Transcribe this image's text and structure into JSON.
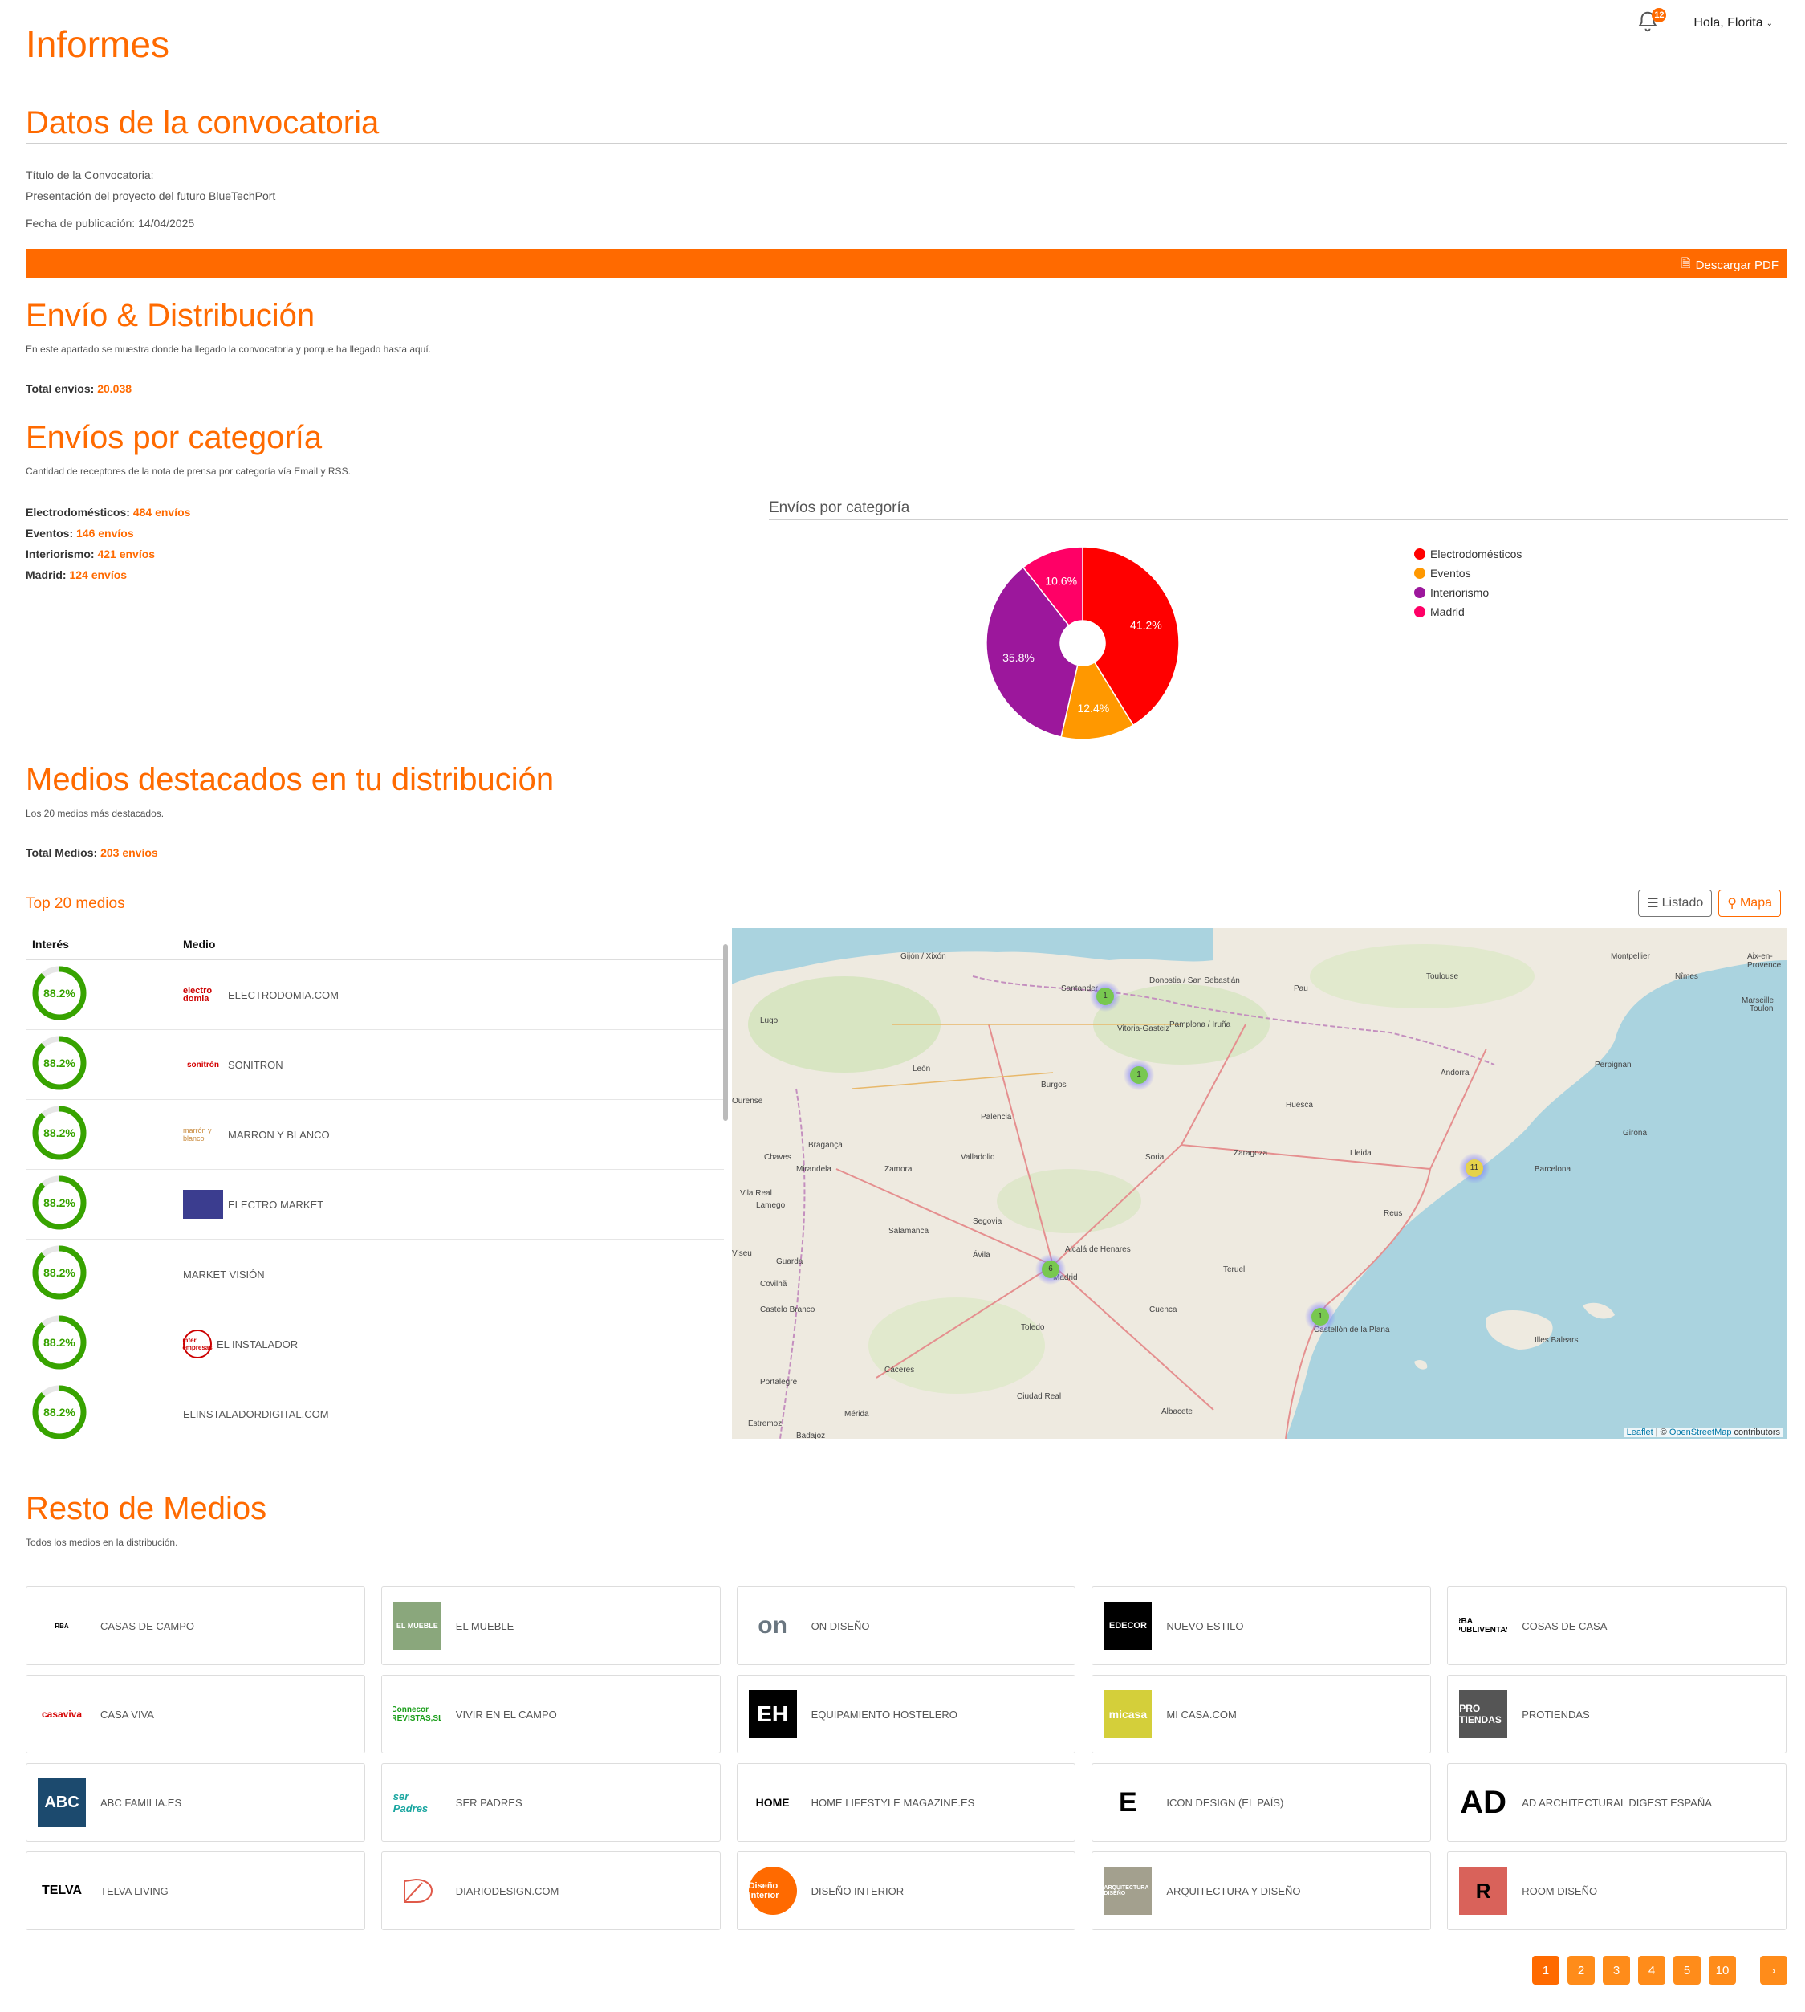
{
  "header": {
    "title": "Informes",
    "greeting": "Hola, Florita",
    "notification_count": "12"
  },
  "convocatoria": {
    "section_title": "Datos de la convocatoria",
    "title_label": "Título de la Convocatoria:",
    "title_value": "Presentación del proyecto del futuro BlueTechPort",
    "date_text": "Fecha de publicación: 14/04/2025",
    "pdf_button": "Descargar PDF"
  },
  "envio": {
    "section_title": "Envío & Distribución",
    "description": "En este apartado se muestra donde ha llegado la convocatoria y porque ha llegado hasta aquí.",
    "total_label": "Total envíos:",
    "total_value": "20.038"
  },
  "categorias": {
    "section_title": "Envíos por categoría",
    "description": "Cantidad de receptores de la nota de prensa por categoría vía Email y RSS.",
    "items": [
      {
        "label": "Electrodomésticos:",
        "value": "484 envíos"
      },
      {
        "label": "Eventos:",
        "value": "146 envíos"
      },
      {
        "label": "Interiorismo:",
        "value": "421 envíos"
      },
      {
        "label": "Madrid:",
        "value": "124 envíos"
      }
    ]
  },
  "chart_data": {
    "type": "pie",
    "title": "Envíos por categoría",
    "categories": [
      "Electrodomésticos",
      "Eventos",
      "Interiorismo",
      "Madrid"
    ],
    "values": [
      41.2,
      12.4,
      35.8,
      10.6
    ],
    "value_labels": [
      "41.2%",
      "12.4%",
      "35.8%",
      "10.6%"
    ],
    "colors": [
      "#ff0000",
      "#ff9800",
      "#9c179c",
      "#ff0066"
    ],
    "legend_position": "right"
  },
  "medios": {
    "section_title": "Medios destacados en tu distribución",
    "description": "Los 20 medios más destacados.",
    "total_label": "Total Medios:",
    "total_value": "203 envíos",
    "top_label": "Top 20 medios",
    "btn_list": "Listado",
    "btn_map": "Mapa",
    "col_interes": "Interés",
    "col_medio": "Medio",
    "rows": [
      {
        "interes": "88.2%",
        "interes_value": 0.882,
        "medio": "ELECTRODOMIA.COM",
        "logo": "electro domia"
      },
      {
        "interes": "88.2%",
        "interes_value": 0.882,
        "medio": "SONITRON",
        "logo": "sonitrón"
      },
      {
        "interes": "88.2%",
        "interes_value": 0.882,
        "medio": "MARRON Y BLANCO",
        "logo": "marrón y blanco"
      },
      {
        "interes": "88.2%",
        "interes_value": 0.882,
        "medio": "ELECTRO MARKET",
        "logo": ""
      },
      {
        "interes": "88.2%",
        "interes_value": 0.882,
        "medio": "MARKET VISIÓN",
        "logo": ""
      },
      {
        "interes": "88.2%",
        "interes_value": 0.882,
        "medio": "EL INSTALADOR",
        "logo": "inter empresas"
      },
      {
        "interes": "88.2%",
        "interes_value": 0.882,
        "medio": "ELINSTALADORDIGITAL.COM",
        "logo": ""
      }
    ]
  },
  "map": {
    "attribution_leaflet": "Leaflet",
    "attribution_sep": " | © ",
    "attribution_osm": "OpenStreetMap",
    "attribution_tail": " contributors",
    "clusters": [
      "1",
      "1",
      "11",
      "6",
      "1"
    ],
    "cities": [
      "Gijón / Xixón",
      "Santander",
      "Donostia / San Sebastián",
      "Pau",
      "Toulouse",
      "Montpellier",
      "Nîmes",
      "Aix-en-Provence",
      "Marseille",
      "Toulon",
      "Lugo",
      "Pamplona / Iruña",
      "Vitoria-Gasteiz",
      "León",
      "Burgos",
      "Andorra",
      "Perpignan",
      "Ourense",
      "Huesca",
      "Palencia",
      "Girona",
      "Bragança",
      "Chaves",
      "Valladolid",
      "Zaragoza",
      "Lleida",
      "Soria",
      "Mirandela",
      "Zamora",
      "Barcelona",
      "Vila Real",
      "Lamego",
      "Segovia",
      "Reus",
      "Salamanca",
      "Viseu",
      "Guarda",
      "Ávila",
      "Alcalá de Henares",
      "Madrid",
      "Teruel",
      "Covilhã",
      "Castelo Branco",
      "Cuenca",
      "Toledo",
      "Castellón de la Plana",
      "Portalegre",
      "Cáceres",
      "Ciudad Real",
      "Mérida",
      "Albacete",
      "Badajoz",
      "Estremoz",
      "Illes Balears"
    ]
  },
  "resto": {
    "section_title": "Resto de Medios",
    "description": "Todos los medios en la distribución.",
    "cards": [
      {
        "name": "CASAS DE CAMPO",
        "logo": "RBA"
      },
      {
        "name": "EL MUEBLE",
        "logo": "EL MUEBLE"
      },
      {
        "name": "ON DISEÑO",
        "logo": "on"
      },
      {
        "name": "NUEVO ESTILO",
        "logo": "EDECOR"
      },
      {
        "name": "COSAS DE CASA",
        "logo": "RBA PUBLIVENTAS"
      },
      {
        "name": "CASA VIVA",
        "logo": "casaviva"
      },
      {
        "name": "VIVIR EN EL CAMPO",
        "logo": "Connecor REVISTAS,SL"
      },
      {
        "name": "EQUIPAMIENTO HOSTELERO",
        "logo": "EH"
      },
      {
        "name": "MI CASA.COM",
        "logo": "micasa"
      },
      {
        "name": "PROTIENDAS",
        "logo": "PRO TIENDAS"
      },
      {
        "name": "ABC FAMILIA.ES",
        "logo": "ABC"
      },
      {
        "name": "SER PADRES",
        "logo": "ser Padres"
      },
      {
        "name": "HOME LIFESTYLE MAGAZINE.ES",
        "logo": "HOME"
      },
      {
        "name": "ICON DESIGN (EL PAÍS)",
        "logo": "E"
      },
      {
        "name": "AD ARCHITECTURAL DIGEST ESPAÑA",
        "logo": "AD"
      },
      {
        "name": "TELVA LIVING",
        "logo": "TELVA"
      },
      {
        "name": "DIARIODESIGN.COM",
        "logo": ""
      },
      {
        "name": "DISEÑO INTERIOR",
        "logo": "Diseño Interior"
      },
      {
        "name": "ARQUITECTURA Y DISEÑO",
        "logo": "ARQUITECTURA DISEÑO"
      },
      {
        "name": "ROOM DISEÑO",
        "logo": "R"
      }
    ]
  },
  "pagination": {
    "pages": [
      "1",
      "2",
      "3",
      "4",
      "5",
      "10"
    ],
    "next": "›",
    "current": "1"
  }
}
